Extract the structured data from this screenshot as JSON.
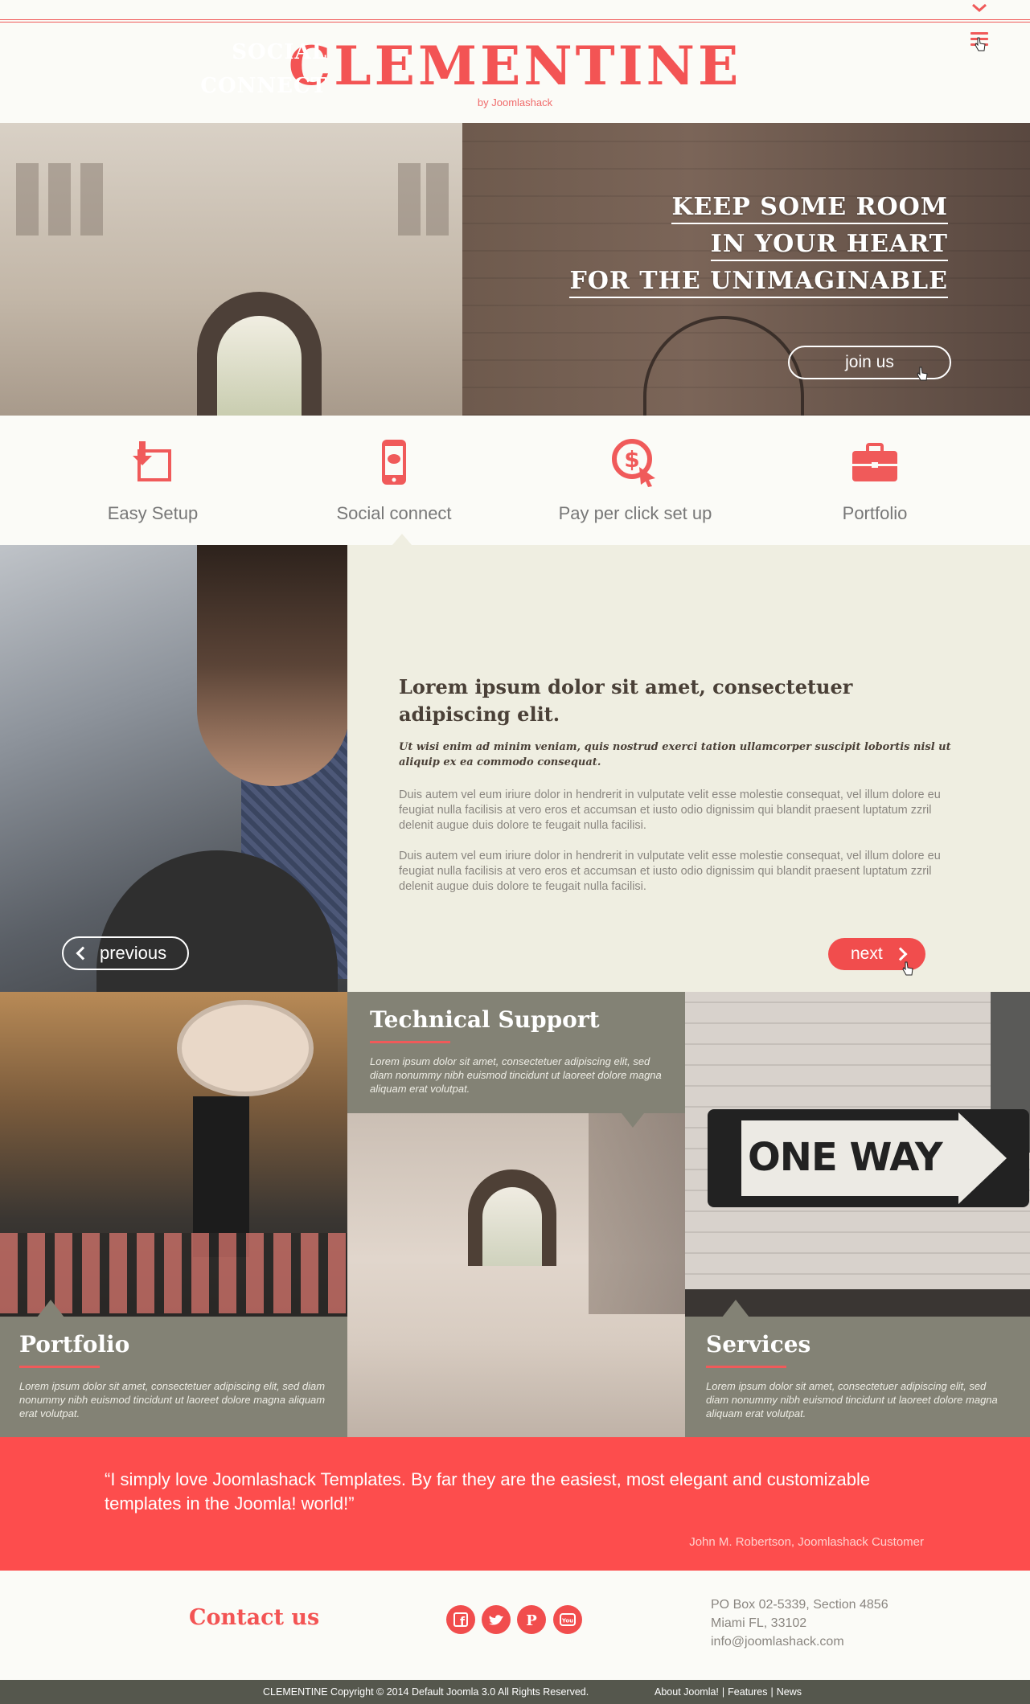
{
  "brand": {
    "title": "CLEMENTINE",
    "subtitle": "by Joomlashack",
    "accent": "#f35454"
  },
  "header": {
    "menu_icon": "hamburger-menu-icon",
    "toggle_icon": "chevron-down-icon"
  },
  "hero": {
    "lines": [
      "KEEP SOME ROOM",
      "IN YOUR HEART",
      "FOR THE UNIMAGINABLE"
    ],
    "cta": "join us"
  },
  "features": [
    {
      "label": "Easy Setup",
      "icon": "setup-arrow-icon"
    },
    {
      "label": "Social connect",
      "icon": "phone-chat-icon"
    },
    {
      "label": "Pay per click set up",
      "icon": "dollar-click-icon"
    },
    {
      "label": "Portfolio",
      "icon": "briefcase-icon"
    }
  ],
  "social_connect": {
    "title_line1": "SOCIAL",
    "title_line2": "CONNECT",
    "heading": "Lorem ipsum dolor sit amet, consectetuer adipiscing elit.",
    "lead": "Ut wisi enim ad minim veniam, quis nostrud exerci tation ullamcorper suscipit lobortis nisl ut aliquip ex ea commodo consequat.",
    "para1": "Duis autem vel eum iriure dolor in hendrerit in vulputate velit esse molestie consequat, vel illum dolore eu feugiat nulla facilisis at vero eros et accumsan et iusto odio dignissim qui blandit praesent luptatum zzril delenit augue duis dolore te feugait nulla facilisi.",
    "para2": "Duis autem vel eum iriure dolor in hendrerit in vulputate velit esse molestie consequat, vel illum dolore eu feugiat nulla facilisis at vero eros et accumsan et iusto odio dignissim qui blandit praesent luptatum zzril delenit augue duis dolore te feugait nulla facilisi.",
    "prev": "previous",
    "next": "next"
  },
  "tiles": {
    "portfolio": {
      "title": "Portfolio",
      "text": "Lorem ipsum dolor sit amet, consectetuer adipiscing elit, sed diam nonummy nibh euismod tincidunt ut laoreet dolore magna aliquam erat volutpat."
    },
    "support": {
      "title": "Technical Support",
      "text": "Lorem ipsum dolor sit amet, consectetuer adipiscing elit, sed diam nonummy nibh euismod tincidunt ut laoreet dolore magna aliquam erat volutpat."
    },
    "services": {
      "title": "Services",
      "text": "Lorem ipsum dolor sit amet, consectetuer adipiscing elit, sed diam nonummy nibh euismod tincidunt ut laoreet dolore magna aliquam erat volutpat."
    },
    "sign_text": "ONE WAY"
  },
  "quote": {
    "text": "“I simply love Joomlashack Templates. By far they are the easiest, most elegant and customizable templates in the Joomla! world!”",
    "author": "John M. Robertson, Joomlashack Customer"
  },
  "footer": {
    "contact_title": "Contact us",
    "social": [
      {
        "icon": "facebook-icon",
        "glyph": "f"
      },
      {
        "icon": "twitter-icon",
        "glyph": "t"
      },
      {
        "icon": "pinterest-icon",
        "glyph": "P"
      },
      {
        "icon": "youtube-icon",
        "glyph": "You"
      }
    ],
    "address": [
      "PO Box 02-5339, Section 4856",
      "Miami FL, 33102",
      "info@joomlashack.com"
    ],
    "copyright": "CLEMENTINE Copyright © 2014 Default Joomla 3.0 All Rights Reserved.",
    "links": [
      "About Joomla!",
      "Features",
      "News"
    ]
  }
}
